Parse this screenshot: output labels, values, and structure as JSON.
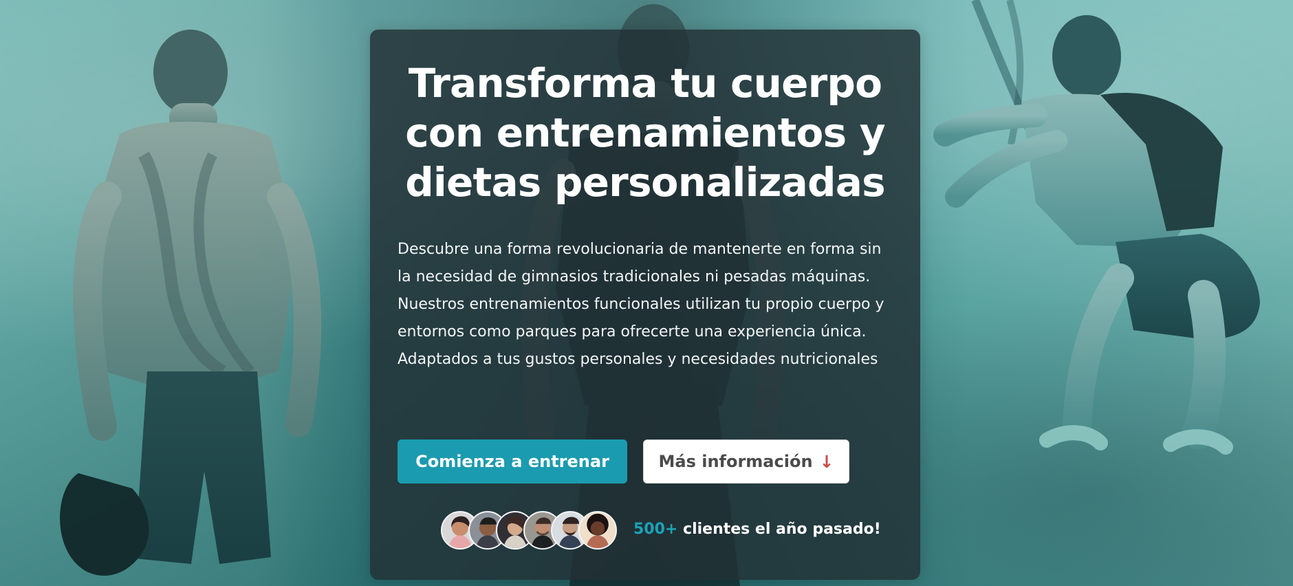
{
  "hero": {
    "title": "Transforma tu cuerpo con entrenamientos y dietas personalizadas",
    "description": "Descubre una forma revolucionaria de mantenerte en forma sin la necesidad de gimnasios tradicionales ni pesadas máquinas. Nuestros entrenamientos funcionales utilizan tu propio cuerpo y entornos como parques para ofrecerte una experiencia única. Adaptados a tus gustos personales y necesidades nutricionales",
    "buttons": {
      "primary_label": "Comienza a entrenar",
      "secondary_label": "Más información",
      "secondary_icon": "↓"
    },
    "social_proof": {
      "count": "500+",
      "text": "clientes el año pasado!"
    }
  },
  "colors": {
    "card_background": "#223034",
    "primary_button": "#1b9bb0",
    "secondary_button": "#ffffff",
    "accent_text": "#1ba3b7",
    "title_text": "#ffffff",
    "body_text": "#f3f6f7"
  },
  "icons": {
    "secondary_button_icon": "arrow-down-icon"
  }
}
